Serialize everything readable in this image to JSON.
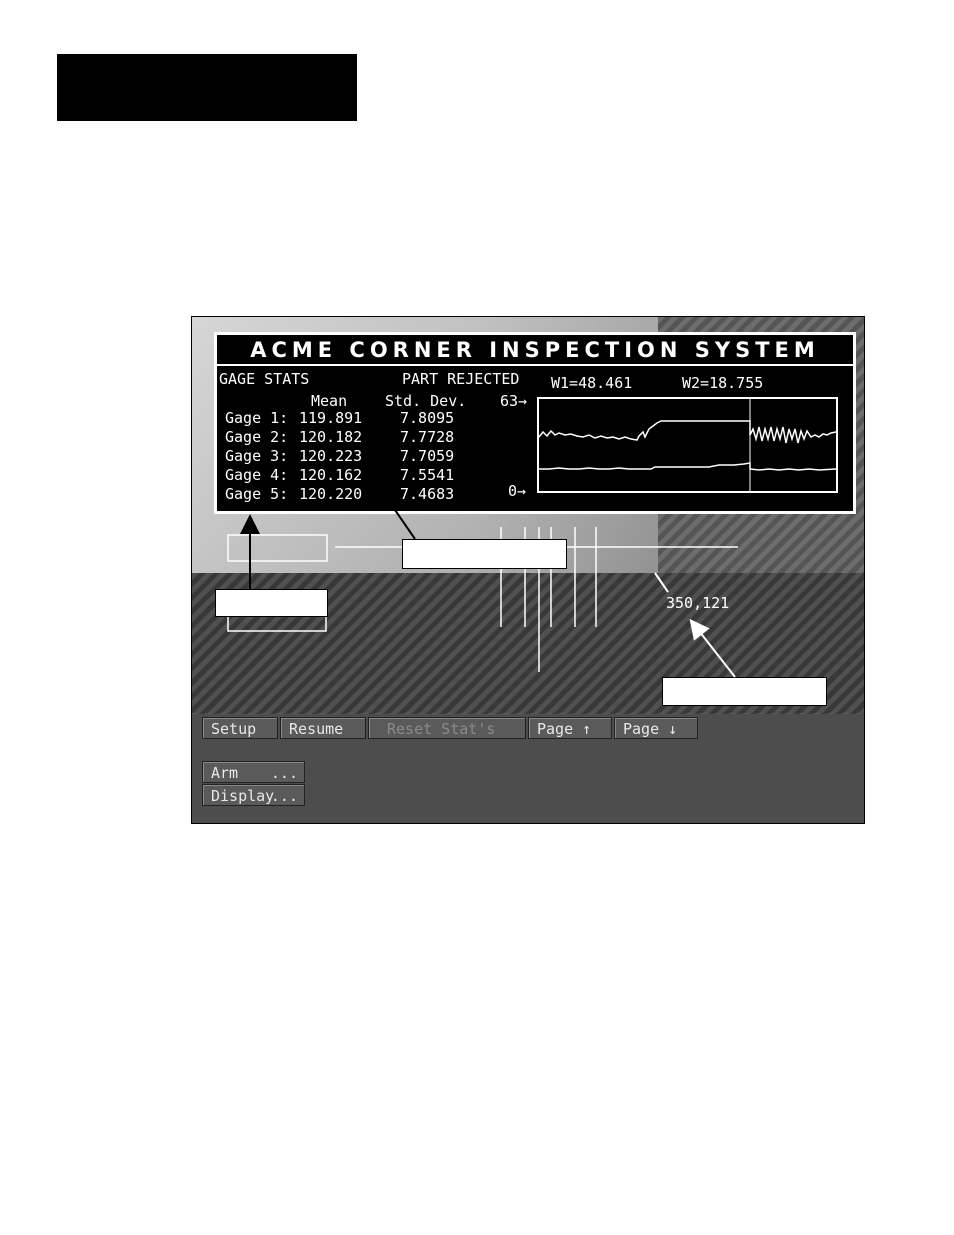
{
  "screen": {
    "title": "ACME CORNER INSPECTION SYSTEM",
    "stats_heading": "GAGE STATS",
    "status": "PART REJECTED",
    "w1": "W1=48.461",
    "w2": "W2=18.755",
    "col_mean": "Mean",
    "col_std": "Std. Dev.",
    "scale_top": "63→",
    "scale_bottom": "0→",
    "gages": [
      {
        "label": "Gage 1:",
        "mean": "119.891",
        "std": "7.8095"
      },
      {
        "label": "Gage 2:",
        "mean": "120.182",
        "std": "7.7728"
      },
      {
        "label": "Gage 3:",
        "mean": "120.223",
        "std": "7.7059"
      },
      {
        "label": "Gage 4:",
        "mean": "120.162",
        "std": "7.5541"
      },
      {
        "label": "Gage 5:",
        "mean": "120.220",
        "std": "7.4683"
      }
    ],
    "cursor_coord": "350,121"
  },
  "softkeys": {
    "setup": "Setup",
    "resume": "Resume",
    "reset": "Reset Stat's",
    "page_up": "Page ↑",
    "page_down": "Page ↓",
    "arm": "Arm",
    "display": "Display",
    "more": "..."
  },
  "colors": {
    "panel_bg": "#000000",
    "text": "#ffffff",
    "softkey_bg": "#5a5a5a"
  }
}
